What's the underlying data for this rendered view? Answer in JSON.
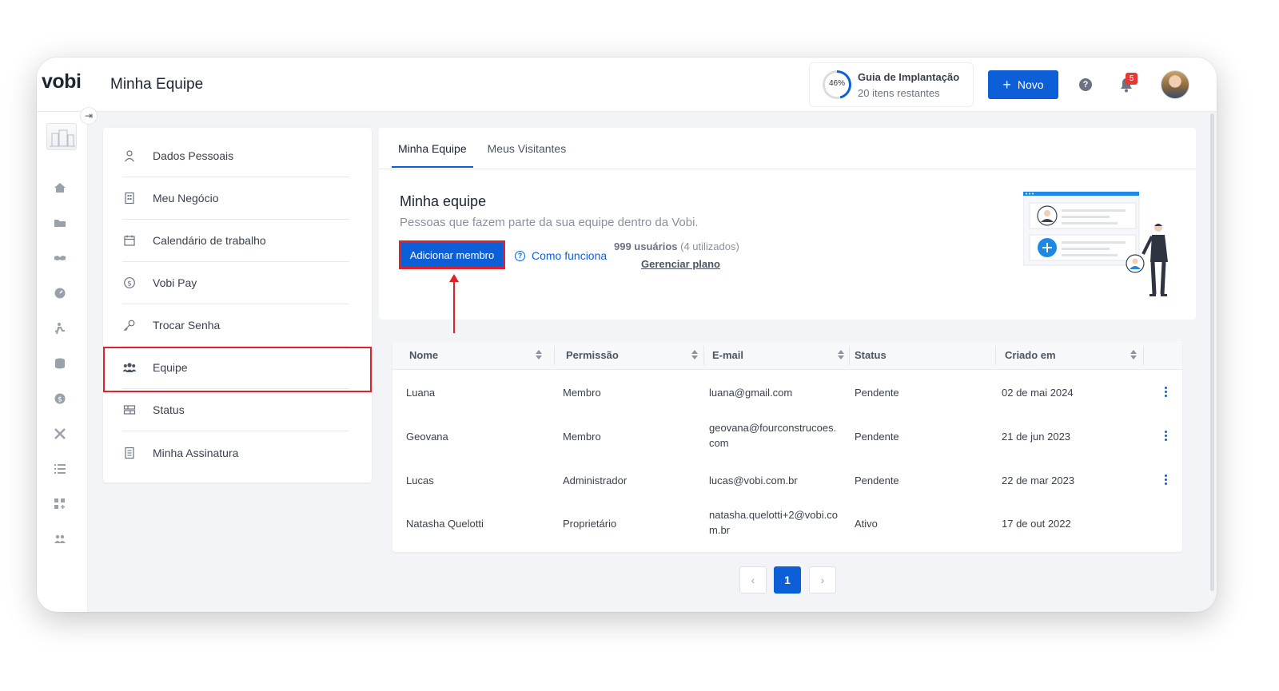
{
  "app": {
    "logo": "vobi",
    "page_title": "Minha Equipe"
  },
  "header": {
    "guide": {
      "percent": "46%",
      "progress": 0.46,
      "title": "Guia de Implantação",
      "subtitle": "20 itens restantes"
    },
    "new_button": {
      "plus": "+",
      "label": "Novo"
    },
    "help_glyph": "?",
    "notifications_count": "5"
  },
  "settings_menu": {
    "items": [
      {
        "label": "Dados Pessoais",
        "icon": "user-icon"
      },
      {
        "label": "Meu Negócio",
        "icon": "building-icon"
      },
      {
        "label": "Calendário de trabalho",
        "icon": "calendar-icon"
      },
      {
        "label": "Vobi Pay",
        "icon": "dollar-circle-icon"
      },
      {
        "label": "Trocar Senha",
        "icon": "key-icon"
      },
      {
        "label": "Equipe",
        "icon": "team-icon",
        "active": true
      },
      {
        "label": "Status",
        "icon": "status-icon"
      },
      {
        "label": "Minha Assinatura",
        "icon": "document-icon"
      }
    ]
  },
  "tabs": [
    {
      "label": "Minha Equipe",
      "active": true
    },
    {
      "label": "Meus Visitantes",
      "active": false
    }
  ],
  "section": {
    "title": "Minha equipe",
    "subtitle": "Pessoas que fazem parte da sua equipe dentro da Vobi.",
    "add_button": "Adicionar membro",
    "how_it_works": "Como funciona",
    "users_count": "999 usuários",
    "users_used": "(4 utilizados)",
    "manage_plan": "Gerenciar plano"
  },
  "table": {
    "columns": [
      "Nome",
      "Permissão",
      "E-mail",
      "Status",
      "Criado em"
    ],
    "rows": [
      {
        "nome": "Luana",
        "permissao": "Membro",
        "email": "luana@gmail.com",
        "status": "Pendente",
        "criado": "02 de mai 2024",
        "actions": true
      },
      {
        "nome": "Geovana",
        "permissao": "Membro",
        "email": "geovana@fourconstrucoes.\ncom",
        "status": "Pendente",
        "criado": "21 de jun 2023",
        "actions": true
      },
      {
        "nome": "Lucas",
        "permissao": "Administrador",
        "email": "lucas@vobi.com.br",
        "status": "Pendente",
        "criado": "22 de mar 2023",
        "actions": true
      },
      {
        "nome": "Natasha Quelotti",
        "permissao": "Proprietário",
        "email": "natasha.quelotti+2@vobi.co\nm.br",
        "status": "Ativo",
        "criado": "17 de out 2022",
        "actions": false
      }
    ]
  },
  "pagination": {
    "prev": "‹",
    "current": "1",
    "next": "›"
  },
  "colors": {
    "primary": "#0d5fd8",
    "highlight": "#e0212b",
    "danger": "#e53935"
  }
}
